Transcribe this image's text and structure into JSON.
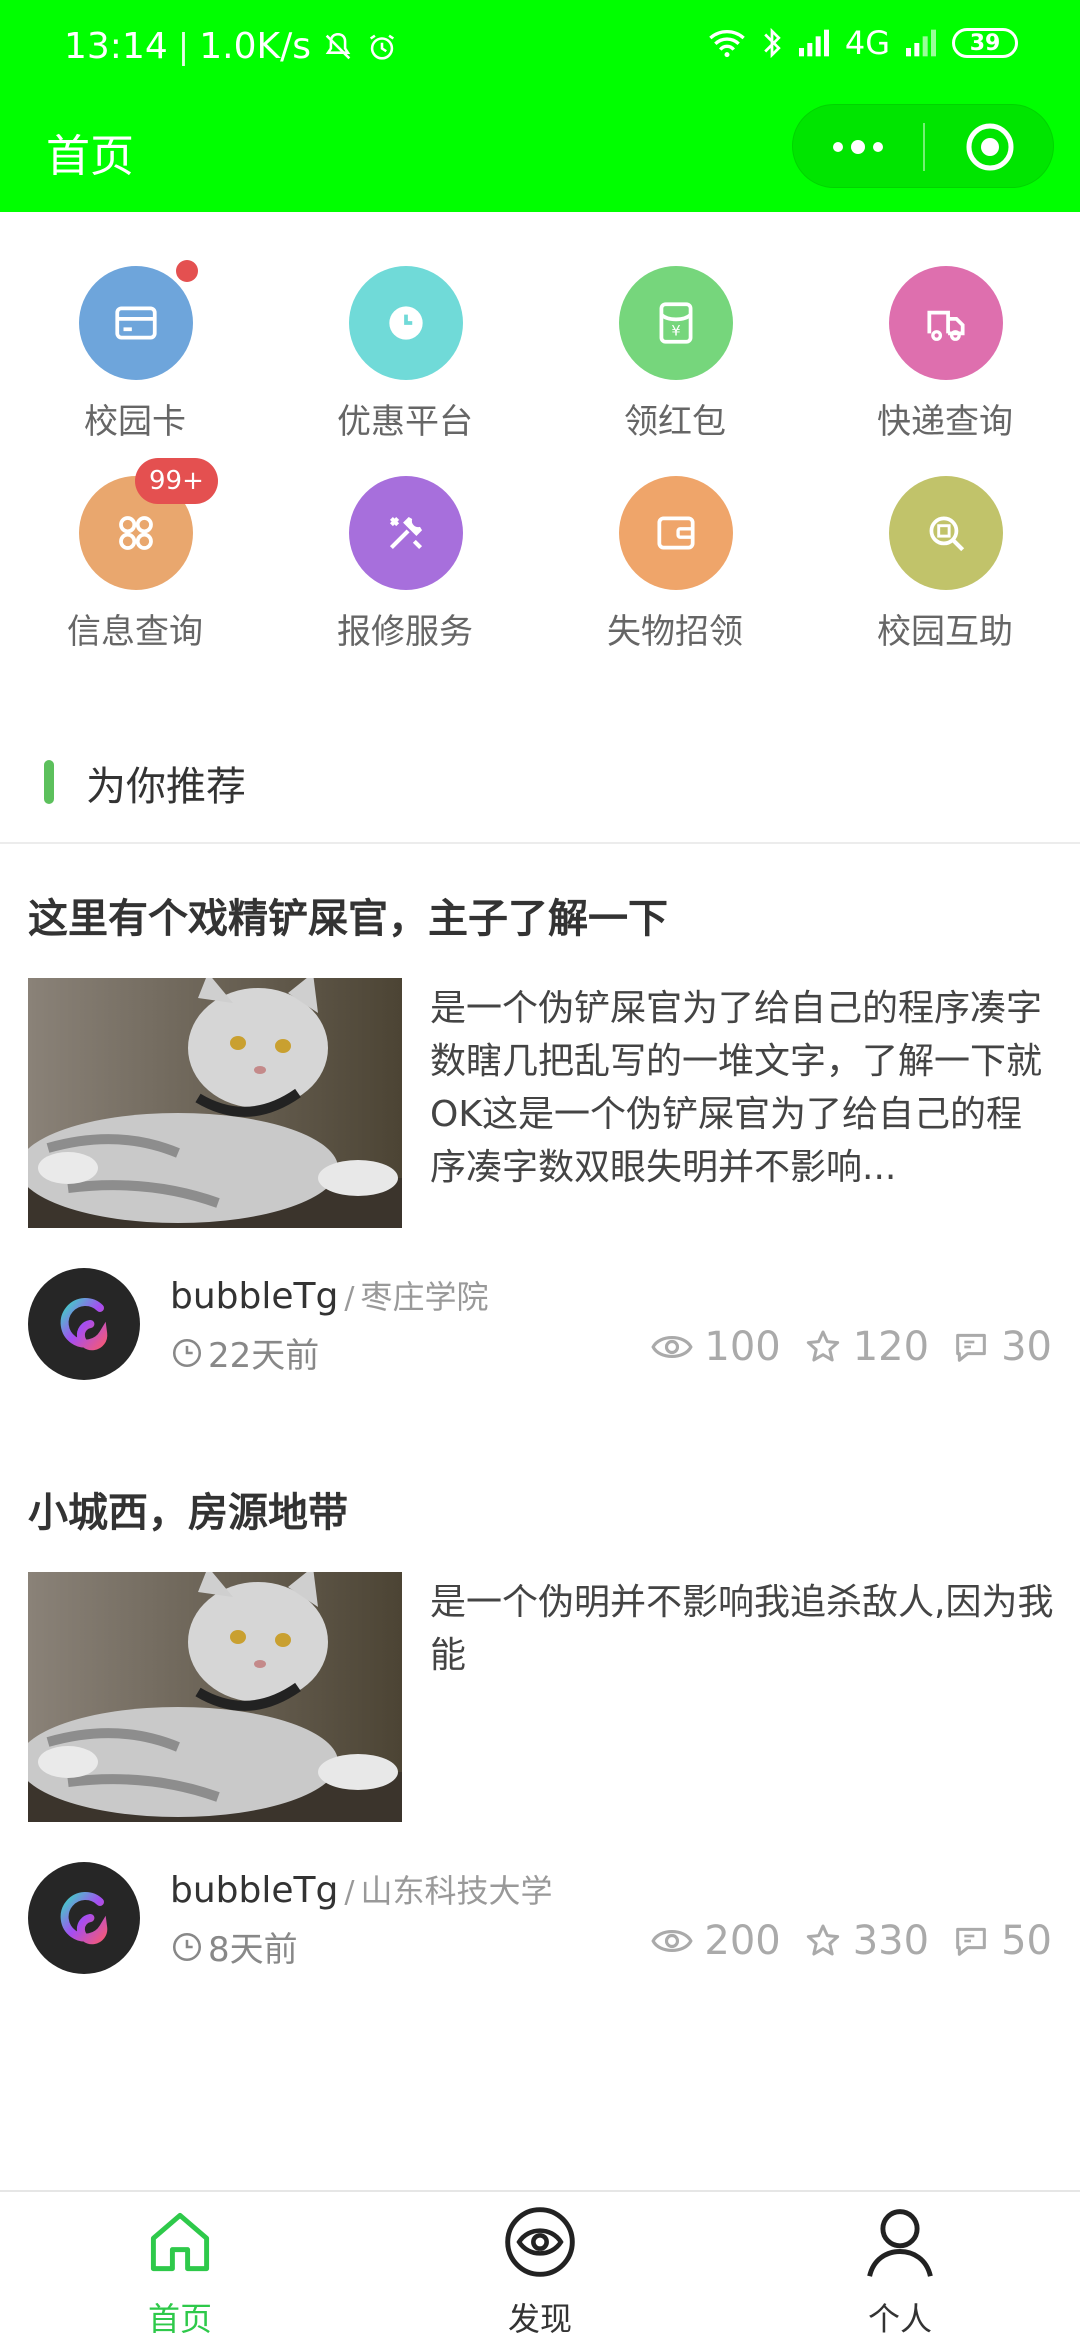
{
  "status_bar": {
    "time": "13:14",
    "speed": "1.0K/s",
    "network": "4G",
    "battery": "39"
  },
  "nav": {
    "title": "首页"
  },
  "grid": [
    {
      "label": "校园卡",
      "icon": "card-icon",
      "color": "#6ea5db"
    },
    {
      "label": "优惠平台",
      "icon": "clock-icon",
      "color": "#70dad8"
    },
    {
      "label": "领红包",
      "icon": "red-packet-icon",
      "color": "#76d67c"
    },
    {
      "label": "快递查询",
      "icon": "delivery-truck-icon",
      "color": "#de6fae"
    },
    {
      "label": "信息查询",
      "icon": "apps-icon",
      "color": "#e9a76e",
      "badge": "99+"
    },
    {
      "label": "报修服务",
      "icon": "tools-icon",
      "color": "#a76fdc"
    },
    {
      "label": "失物招领",
      "icon": "wallet-icon",
      "color": "#efa56a"
    },
    {
      "label": "校园互助",
      "icon": "search-doc-icon",
      "color": "#c1c36a"
    }
  ],
  "section": {
    "title": "为你推荐"
  },
  "articles": [
    {
      "title": "这里有个戏精铲屎官，主子了解一下",
      "summary": "是一个伪铲屎官为了给自己的程序凑字数瞎几把乱写的一堆文字，了解一下就OK这是一个伪铲屎官为了给自己的程序凑字数双眼失明并不影响...",
      "author": "bubbleTg",
      "separator": "/",
      "school": "枣庄学院",
      "time": "22天前",
      "views": "100",
      "stars": "120",
      "comments": "30"
    },
    {
      "title": "小城西，房源地带",
      "summary": "是一个伪明并不影响我追杀敌人,因为我能",
      "author": "bubbleTg",
      "separator": "/",
      "school": "山东科技大学",
      "time": "8天前",
      "views": "200",
      "stars": "330",
      "comments": "50"
    }
  ],
  "tabbar": [
    {
      "label": "首页",
      "icon": "home-icon",
      "active": true
    },
    {
      "label": "发现",
      "icon": "eye-icon",
      "active": false
    },
    {
      "label": "个人",
      "icon": "person-icon",
      "active": false
    }
  ],
  "colors": {
    "header": "#00ff00",
    "accent": "#2ec94a",
    "badge": "#e45050"
  }
}
